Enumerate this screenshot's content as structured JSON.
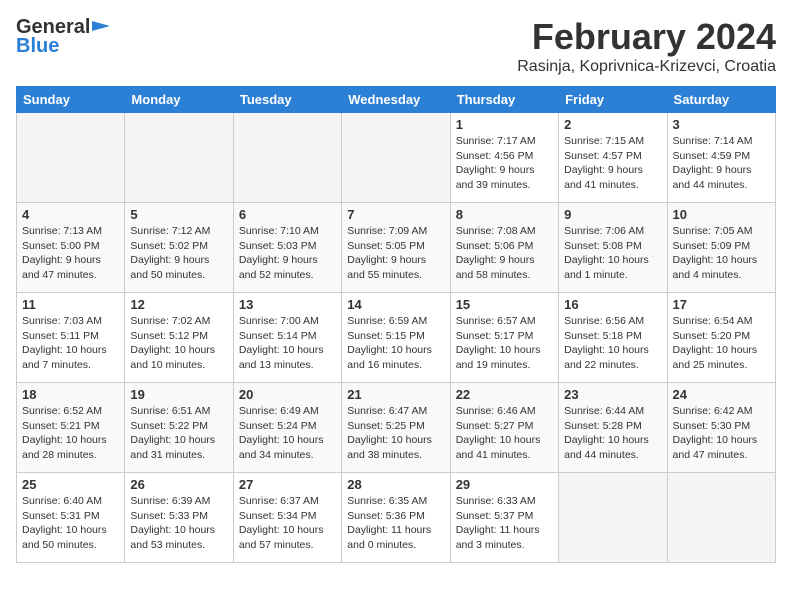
{
  "logo": {
    "general": "General",
    "blue": "Blue"
  },
  "title": "February 2024",
  "subtitle": "Rasinja, Koprivnica-Krizevci, Croatia",
  "weekdays": [
    "Sunday",
    "Monday",
    "Tuesday",
    "Wednesday",
    "Thursday",
    "Friday",
    "Saturday"
  ],
  "weeks": [
    [
      {
        "day": "",
        "info": ""
      },
      {
        "day": "",
        "info": ""
      },
      {
        "day": "",
        "info": ""
      },
      {
        "day": "",
        "info": ""
      },
      {
        "day": "1",
        "info": "Sunrise: 7:17 AM\nSunset: 4:56 PM\nDaylight: 9 hours\nand 39 minutes."
      },
      {
        "day": "2",
        "info": "Sunrise: 7:15 AM\nSunset: 4:57 PM\nDaylight: 9 hours\nand 41 minutes."
      },
      {
        "day": "3",
        "info": "Sunrise: 7:14 AM\nSunset: 4:59 PM\nDaylight: 9 hours\nand 44 minutes."
      }
    ],
    [
      {
        "day": "4",
        "info": "Sunrise: 7:13 AM\nSunset: 5:00 PM\nDaylight: 9 hours\nand 47 minutes."
      },
      {
        "day": "5",
        "info": "Sunrise: 7:12 AM\nSunset: 5:02 PM\nDaylight: 9 hours\nand 50 minutes."
      },
      {
        "day": "6",
        "info": "Sunrise: 7:10 AM\nSunset: 5:03 PM\nDaylight: 9 hours\nand 52 minutes."
      },
      {
        "day": "7",
        "info": "Sunrise: 7:09 AM\nSunset: 5:05 PM\nDaylight: 9 hours\nand 55 minutes."
      },
      {
        "day": "8",
        "info": "Sunrise: 7:08 AM\nSunset: 5:06 PM\nDaylight: 9 hours\nand 58 minutes."
      },
      {
        "day": "9",
        "info": "Sunrise: 7:06 AM\nSunset: 5:08 PM\nDaylight: 10 hours\nand 1 minute."
      },
      {
        "day": "10",
        "info": "Sunrise: 7:05 AM\nSunset: 5:09 PM\nDaylight: 10 hours\nand 4 minutes."
      }
    ],
    [
      {
        "day": "11",
        "info": "Sunrise: 7:03 AM\nSunset: 5:11 PM\nDaylight: 10 hours\nand 7 minutes."
      },
      {
        "day": "12",
        "info": "Sunrise: 7:02 AM\nSunset: 5:12 PM\nDaylight: 10 hours\nand 10 minutes."
      },
      {
        "day": "13",
        "info": "Sunrise: 7:00 AM\nSunset: 5:14 PM\nDaylight: 10 hours\nand 13 minutes."
      },
      {
        "day": "14",
        "info": "Sunrise: 6:59 AM\nSunset: 5:15 PM\nDaylight: 10 hours\nand 16 minutes."
      },
      {
        "day": "15",
        "info": "Sunrise: 6:57 AM\nSunset: 5:17 PM\nDaylight: 10 hours\nand 19 minutes."
      },
      {
        "day": "16",
        "info": "Sunrise: 6:56 AM\nSunset: 5:18 PM\nDaylight: 10 hours\nand 22 minutes."
      },
      {
        "day": "17",
        "info": "Sunrise: 6:54 AM\nSunset: 5:20 PM\nDaylight: 10 hours\nand 25 minutes."
      }
    ],
    [
      {
        "day": "18",
        "info": "Sunrise: 6:52 AM\nSunset: 5:21 PM\nDaylight: 10 hours\nand 28 minutes."
      },
      {
        "day": "19",
        "info": "Sunrise: 6:51 AM\nSunset: 5:22 PM\nDaylight: 10 hours\nand 31 minutes."
      },
      {
        "day": "20",
        "info": "Sunrise: 6:49 AM\nSunset: 5:24 PM\nDaylight: 10 hours\nand 34 minutes."
      },
      {
        "day": "21",
        "info": "Sunrise: 6:47 AM\nSunset: 5:25 PM\nDaylight: 10 hours\nand 38 minutes."
      },
      {
        "day": "22",
        "info": "Sunrise: 6:46 AM\nSunset: 5:27 PM\nDaylight: 10 hours\nand 41 minutes."
      },
      {
        "day": "23",
        "info": "Sunrise: 6:44 AM\nSunset: 5:28 PM\nDaylight: 10 hours\nand 44 minutes."
      },
      {
        "day": "24",
        "info": "Sunrise: 6:42 AM\nSunset: 5:30 PM\nDaylight: 10 hours\nand 47 minutes."
      }
    ],
    [
      {
        "day": "25",
        "info": "Sunrise: 6:40 AM\nSunset: 5:31 PM\nDaylight: 10 hours\nand 50 minutes."
      },
      {
        "day": "26",
        "info": "Sunrise: 6:39 AM\nSunset: 5:33 PM\nDaylight: 10 hours\nand 53 minutes."
      },
      {
        "day": "27",
        "info": "Sunrise: 6:37 AM\nSunset: 5:34 PM\nDaylight: 10 hours\nand 57 minutes."
      },
      {
        "day": "28",
        "info": "Sunrise: 6:35 AM\nSunset: 5:36 PM\nDaylight: 11 hours\nand 0 minutes."
      },
      {
        "day": "29",
        "info": "Sunrise: 6:33 AM\nSunset: 5:37 PM\nDaylight: 11 hours\nand 3 minutes."
      },
      {
        "day": "",
        "info": ""
      },
      {
        "day": "",
        "info": ""
      }
    ]
  ]
}
